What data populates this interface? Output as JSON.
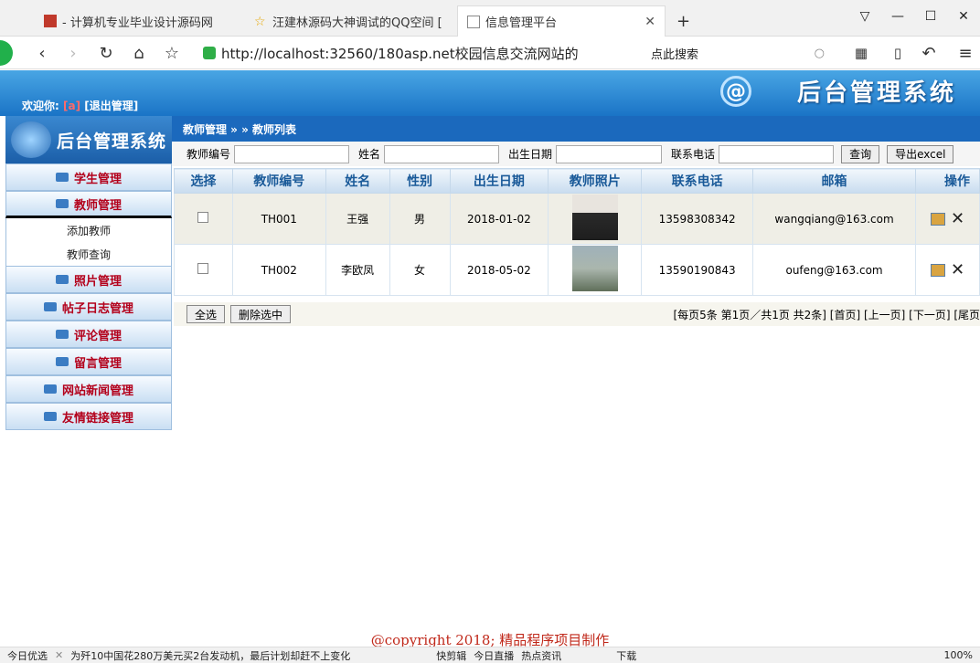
{
  "browser": {
    "tabs": [
      {
        "title": "- 计算机专业毕业设计源码网",
        "active": false
      },
      {
        "title": "汪建林源码大神调试的QQ空间 [",
        "active": false
      },
      {
        "title": "信息管理平台",
        "active": true
      }
    ],
    "new_tab": "+",
    "address": "http://localhost:32560/180asp.net校园信息交流网站的",
    "search_placeholder": "点此搜索"
  },
  "app": {
    "banner_title": "后台管理系统",
    "welcome_label": "欢迎你:",
    "welcome_user": "[a]",
    "logout": "[退出管理]",
    "sidebar_title": "后台管理系统",
    "menu": [
      {
        "label": "学生管理"
      },
      {
        "label": "教师管理",
        "open": true,
        "children": [
          "添加教师",
          "教师查询"
        ]
      },
      {
        "label": "照片管理"
      },
      {
        "label": "帖子日志管理"
      },
      {
        "label": "评论管理"
      },
      {
        "label": "留言管理"
      },
      {
        "label": "网站新闻管理"
      },
      {
        "label": "友情链接管理"
      }
    ],
    "breadcrumb": "教师管理 » » 教师列表",
    "filter": {
      "labels": [
        "教师编号",
        "姓名",
        "出生日期",
        "联系电话"
      ],
      "query_button": "查询",
      "export_button": "导出excel"
    },
    "table": {
      "columns": [
        "选择",
        "教师编号",
        "姓名",
        "性别",
        "出生日期",
        "教师照片",
        "联系电话",
        "邮箱",
        "操作"
      ],
      "rows": [
        {
          "id": "TH001",
          "name": "王强",
          "gender": "男",
          "birth": "2018-01-02",
          "phone": "13598308342",
          "email": "wangqiang@163.com"
        },
        {
          "id": "TH002",
          "name": "李欧凤",
          "gender": "女",
          "birth": "2018-05-02",
          "phone": "13590190843",
          "email": "oufeng@163.com"
        }
      ]
    },
    "select_all": "全选",
    "delete_selected": "删除选中",
    "pager_text": "[每页5条 第1页／共1页 共2条] [首页] [上一页] [下一页] [尾页",
    "copyright": "@copyright 2018; 精品程序项目制作"
  },
  "statusbar": [
    "今日优选",
    "为歼10中国花280万美元买2台发动机，最后计划却赶不上变化",
    "快剪辑",
    "今日直播",
    "热点资讯",
    "下载",
    "100%"
  ]
}
